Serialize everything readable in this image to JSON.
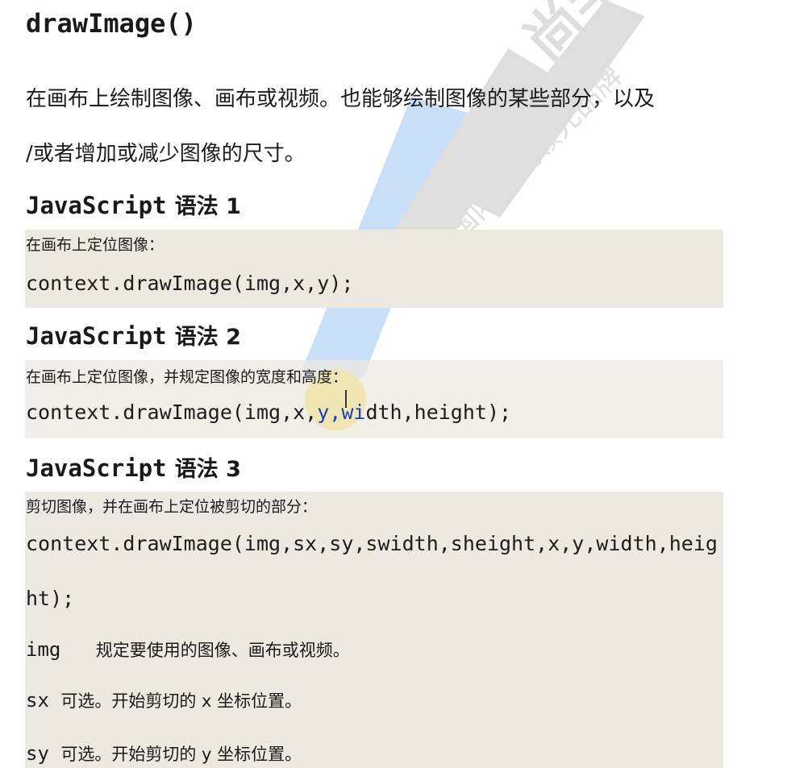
{
  "title": "drawImage()",
  "intro": {
    "line1": "在画布上绘制图像、画布或视频。也能够绘制图像的某些部分，以及",
    "line2": "/或者增加或减少图像的尺寸。"
  },
  "sections": [
    {
      "heading_code": "JavaScript",
      "heading_cn": "语法 1",
      "note": "在画布上定位图像：",
      "code": "context.drawImage(img,x,y);"
    },
    {
      "heading_code": "JavaScript",
      "heading_cn": "语法 2",
      "note": "在画布上定位图像，并规定图像的宽度和高度：",
      "code_pre": "context.drawImage(img,x,",
      "code_highlight": "y,wi",
      "code_post": "dth,height);"
    },
    {
      "heading_code": "JavaScript",
      "heading_cn": "语法 3",
      "note": "剪切图像，并在画布上定位被剪切的部分：",
      "code_line1": "context.drawImage(img,sx,sy,swidth,sheight,x,y,width,heig",
      "code_line2": "ht);"
    }
  ],
  "params": [
    {
      "name": "img",
      "desc": "规定要使用的图像、画布或视频。"
    },
    {
      "name": "sx",
      "desc": "可选。开始剪切的 x 坐标位置。"
    },
    {
      "name": "sy",
      "desc": "可选。开始剪切的 y 坐标位置。"
    }
  ],
  "watermark": {
    "brand": "尚学堂",
    "slogan": "国内高端领先品牌"
  },
  "colors": {
    "code_box_bg": "#ede9e1",
    "highlight": "#f3dc12",
    "watermark_blue": "#3f8fe6",
    "watermark_gray": "#8a8a8a"
  }
}
